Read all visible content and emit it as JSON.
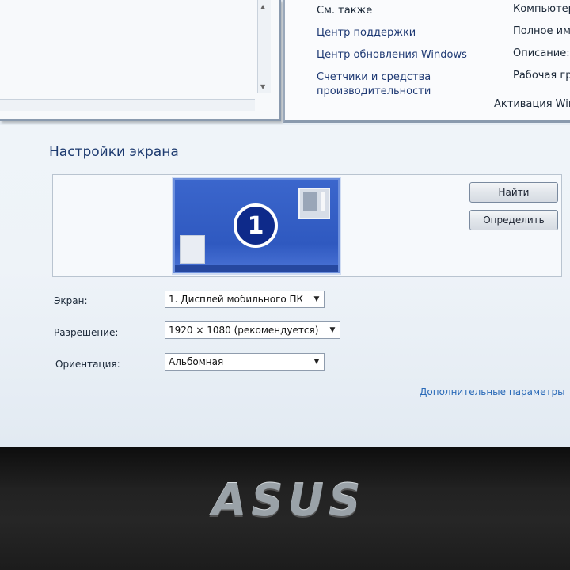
{
  "background": {
    "see_also": {
      "header": "См. также",
      "links": [
        "Центр поддержки",
        "Центр обновления Windows",
        "Счетчики и средства\nпроизводительности"
      ]
    },
    "system_info": [
      "Компьютер:",
      "Полное имя",
      "Описание:",
      "Рабочая гру"
    ],
    "activation": "Активация Wind"
  },
  "panel": {
    "title": "Настройки экрана",
    "monitor_number": "1",
    "buttons": {
      "find": "Найти",
      "identify": "Определить"
    },
    "fields": {
      "display": {
        "label": "Экран:",
        "value": "1. Дисплей мобильного ПК"
      },
      "resolution": {
        "label": "Разрешение:",
        "value": "1920 × 1080 (рекомендуется)"
      },
      "orientation": {
        "label": "Ориентация:",
        "value": "Альбомная"
      }
    },
    "advanced_link": "Дополнительные параметры"
  },
  "bezel": {
    "logo": "ASUS"
  },
  "colors": {
    "accent": "#1e3b70",
    "link": "#2a6ab8",
    "monitor": "#3b66cc"
  }
}
